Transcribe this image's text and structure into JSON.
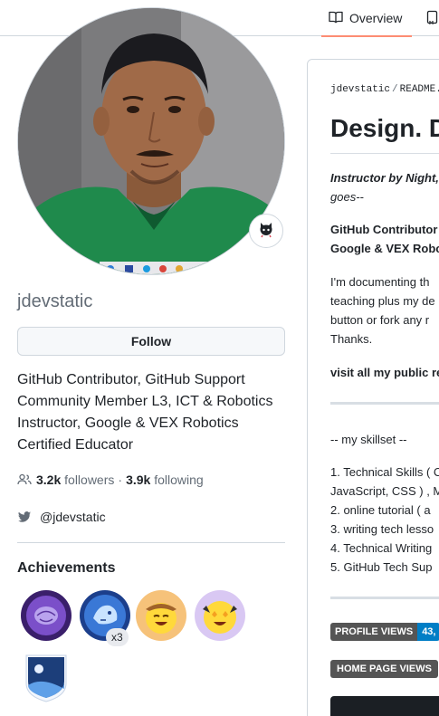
{
  "tabs": {
    "overview_label": "Overview"
  },
  "profile": {
    "username": "jdevstatic",
    "follow_label": "Follow",
    "bio_lines": [
      "GitHub Contributor, GitHub Support",
      "Community Member L3, ICT & Robotics",
      "Instructor, Google & VEX Robotics",
      "Certified Educator"
    ],
    "followers_count": "3.2k",
    "followers_label": "followers",
    "separator": "·",
    "following_count": "3.9k",
    "following_label": "following",
    "twitter_handle": "@jdevstatic",
    "achievements_title": "Achievements",
    "achievement_count": "x3"
  },
  "icons": {
    "overview": "book-icon",
    "next_tab": "repo-icon",
    "status": "octocat-icon",
    "people": "people-icon",
    "twitter": "twitter-icon"
  },
  "readme": {
    "path_user": "jdevstatic",
    "path_sep": "/",
    "path_file": "README.",
    "heading": "Design. D",
    "intro_italic_1": "Instructor by Night,",
    "intro_italic_2": "goes--",
    "bold_line_1": "GitHub Contributor",
    "bold_line_2": "Google & VEX Robo",
    "para_lines": [
      "I'm documenting th",
      "teaching plus my de",
      "button or fork any r",
      "Thanks."
    ],
    "visit_line": "visit all my public re",
    "skillset_header": "-- my skillset --",
    "skills": [
      "1. Technical Skills ( C",
      "JavaScript, CSS ) , M",
      "2. online tutorial ( a",
      "3. writing tech lesso",
      "4. Technical Writing",
      "5. GitHub Tech Sup"
    ],
    "profile_views_label": "PROFILE VIEWS",
    "profile_views_value": "43,",
    "home_page_views_label": "HOME PAGE VIEWS"
  },
  "colors": {
    "tab_underline": "#fd8c73",
    "badge_blue": "#007ec6",
    "badge_gray": "#555555",
    "twitter": "#1f2328"
  }
}
